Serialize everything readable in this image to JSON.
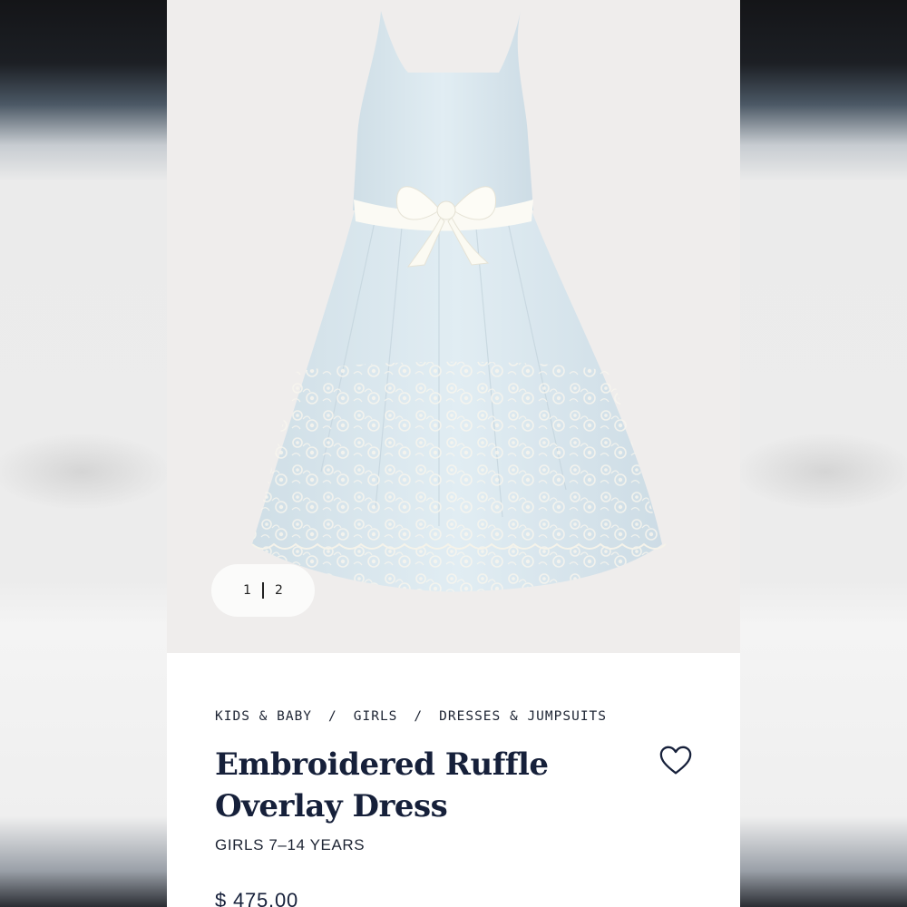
{
  "gallery": {
    "current_page": "1",
    "total_pages": "2",
    "image_alt": "Light blue sleeveless dress with white satin bow and embroidered floral hem"
  },
  "breadcrumb": {
    "items": [
      "KIDS & BABY",
      "GIRLS",
      "DRESSES & JUMPSUITS"
    ],
    "separator": "/"
  },
  "product": {
    "title_line1": "Embroidered Ruffle",
    "title_line2": "Overlay Dress",
    "subtitle": "GIRLS 7–14 YEARS",
    "price": "$ 475.00"
  },
  "colors": {
    "dress": "#dbe9f0",
    "navy_text": "#16203a",
    "hero_bg": "#efedec"
  }
}
